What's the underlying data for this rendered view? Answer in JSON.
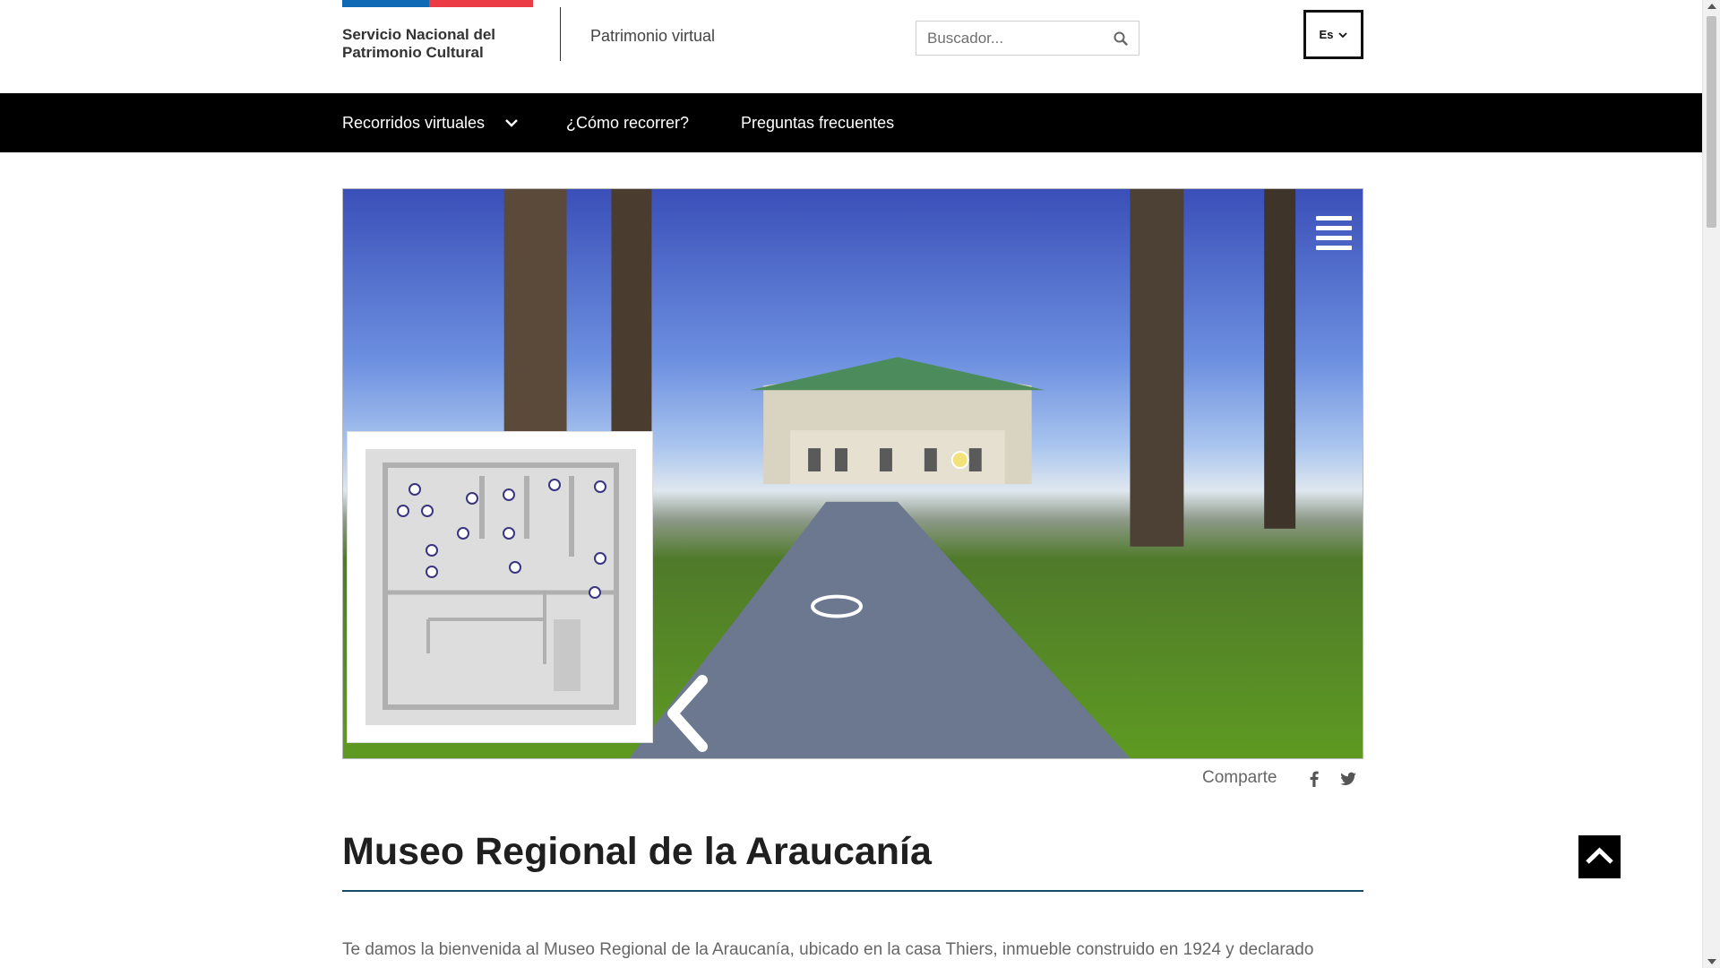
{
  "header": {
    "brand_line1": "Servicio Nacional del",
    "brand_line2": "Patrimonio Cultural",
    "site_name": "Patrimonio virtual",
    "search": {
      "placeholder": "Buscador...",
      "icon": "search-icon"
    },
    "language": {
      "label": "Es",
      "icon": "chevron-down-icon"
    },
    "flag_colors": {
      "blue": "#0f69b4",
      "red": "#eb3c46"
    }
  },
  "nav": {
    "items": [
      {
        "label": "Recorridos virtuales",
        "has_dropdown": true
      },
      {
        "label": "¿Cómo recorrer?"
      },
      {
        "label": "Preguntas frecuentes"
      }
    ]
  },
  "viewer": {
    "menu_icon": "hamburger-icon",
    "prev_icon": "chevron-left-icon",
    "minimap_icon": "floor-plan-map"
  },
  "share": {
    "label": "Comparte",
    "icons": [
      "facebook-icon",
      "twitter-icon"
    ]
  },
  "main": {
    "title": "Museo Regional de la Araucanía",
    "intro": "Te damos la bienvenida al Museo Regional de la Araucanía, ubicado en la casa Thiers, inmueble construido en 1924 y declarado"
  },
  "back_to_top": {
    "icon": "chevron-up-icon"
  },
  "colors": {
    "navbar": "#000000",
    "title_rule": "#0f4d6b"
  }
}
